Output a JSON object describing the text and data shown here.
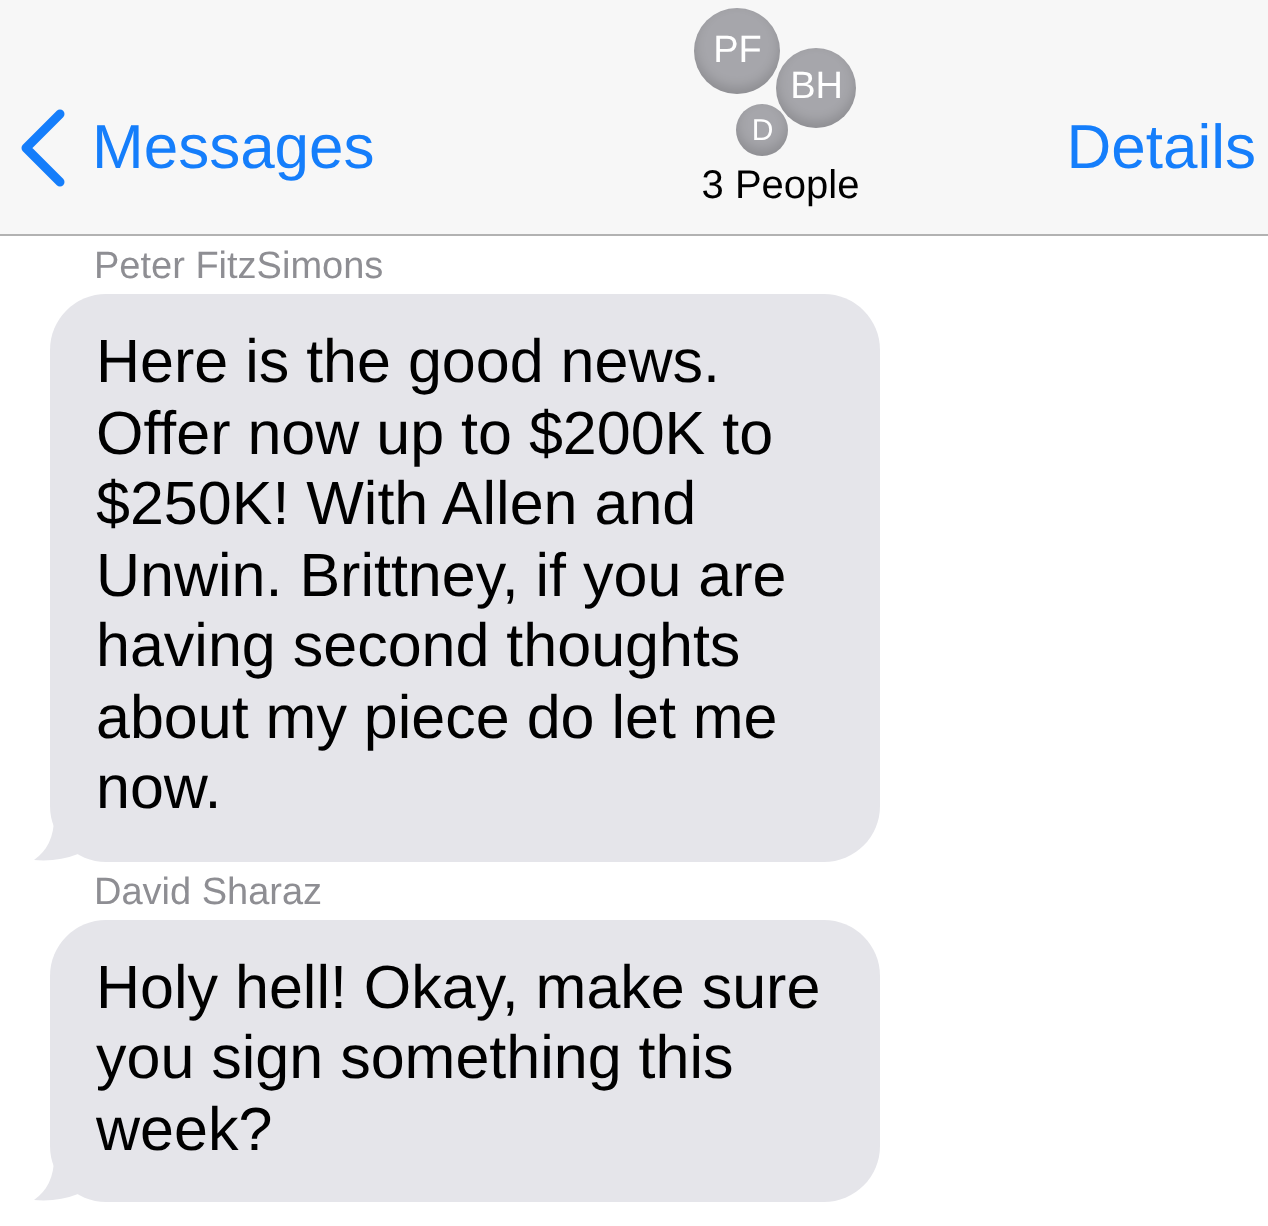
{
  "header": {
    "back_label": "Messages",
    "avatars": [
      {
        "initials": "PF",
        "kind": "large"
      },
      {
        "initials": "BH",
        "kind": "large"
      },
      {
        "initials": "D",
        "kind": "small"
      }
    ],
    "title": "3 People",
    "action": "Details"
  },
  "messages": [
    {
      "sender": "Peter FitzSimons",
      "text": "Here is the good news. Offer now up to $200K to $250K! With Allen and Unwin. Brittney, if you are having second thoughts about my piece do let me now."
    },
    {
      "sender": "David Sharaz",
      "text": "Holy hell! Okay, make sure you sign something this week?"
    }
  ]
}
